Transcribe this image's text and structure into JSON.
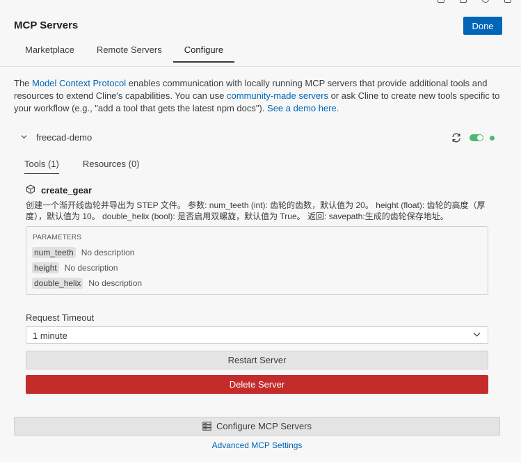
{
  "header": {
    "title": "MCP Servers",
    "done_label": "Done"
  },
  "tabs": [
    {
      "label": "Marketplace"
    },
    {
      "label": "Remote Servers"
    },
    {
      "label": "Configure"
    }
  ],
  "intro": {
    "t1": "The ",
    "link1": "Model Context Protocol",
    "t2": " enables communication with locally running MCP servers that provide additional tools and resources to extend Cline's capabilities. You can use ",
    "link2": "community-made servers",
    "t3": " or ask Cline to create new tools specific to your workflow (e.g., \"add a tool that gets the latest npm docs\"). ",
    "link3": "See a demo here."
  },
  "server": {
    "name": "freecad-demo",
    "enabled": true,
    "status_color": "#4fb870",
    "subtabs": [
      {
        "label": "Tools (1)"
      },
      {
        "label": "Resources (0)"
      }
    ],
    "tool": {
      "name": "create_gear",
      "icon": "cube-icon",
      "description": "创建一个渐开线齿轮并导出为 STEP 文件。 参数: num_teeth (int): 齿轮的齿数，默认值为 20。 height (float): 齿轮的高度（厚度），默认值为 10。 double_helix (bool): 是否启用双螺旋，默认值为 True。 返回: savepath:生成的齿轮保存地址。",
      "parameters_title": "PARAMETERS",
      "parameters": [
        {
          "name": "num_teeth",
          "desc": "No description"
        },
        {
          "name": "height",
          "desc": "No description"
        },
        {
          "name": "double_helix",
          "desc": "No description"
        }
      ]
    },
    "timeout_label": "Request Timeout",
    "timeout_value": "1 minute",
    "restart_label": "Restart Server",
    "delete_label": "Delete Server"
  },
  "footer": {
    "configure_label": "Configure MCP Servers",
    "advanced_label": "Advanced MCP Settings"
  },
  "colors": {
    "accent": "#0066b8",
    "danger": "#c42b2b",
    "success": "#4fb870"
  }
}
